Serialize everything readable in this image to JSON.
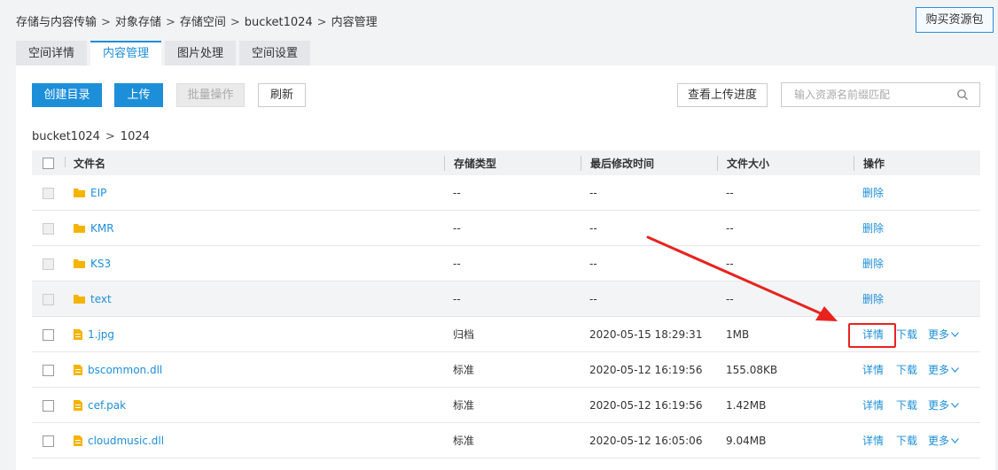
{
  "breadcrumb": [
    "存储与内容传输",
    "对象存储",
    "存储空间",
    "bucket1024",
    "内容管理"
  ],
  "breadcrumb_sep": ">",
  "buy_button": "购买资源包",
  "tabs": [
    {
      "label": "空间详情",
      "active": false
    },
    {
      "label": "内容管理",
      "active": true
    },
    {
      "label": "图片处理",
      "active": false
    },
    {
      "label": "空间设置",
      "active": false
    }
  ],
  "toolbar": {
    "create_dir": "创建目录",
    "upload": "上传",
    "batch": "批量操作",
    "refresh": "刷新",
    "upload_progress": "查看上传进度"
  },
  "search": {
    "placeholder": "输入资源名前缀匹配"
  },
  "path": [
    "bucket1024",
    "1024"
  ],
  "path_sep": ">",
  "columns": {
    "name": "文件名",
    "type": "存储类型",
    "time": "最后修改时间",
    "size": "文件大小",
    "op": "操作"
  },
  "ops": {
    "delete": "删除",
    "detail": "详情",
    "download": "下载",
    "more": "更多"
  },
  "rows": [
    {
      "name": "EIP",
      "kind": "folder",
      "type": "--",
      "time": "--",
      "size": "--"
    },
    {
      "name": "KMR",
      "kind": "folder",
      "type": "--",
      "time": "--",
      "size": "--"
    },
    {
      "name": "KS3",
      "kind": "folder",
      "type": "--",
      "time": "--",
      "size": "--"
    },
    {
      "name": "text",
      "kind": "folder",
      "type": "--",
      "time": "--",
      "size": "--"
    },
    {
      "name": "1.jpg",
      "kind": "file",
      "type": "归档",
      "time": "2020-05-15 18:29:31",
      "size": "1MB"
    },
    {
      "name": "bscommon.dll",
      "kind": "file",
      "type": "标准",
      "time": "2020-05-12 16:19:56",
      "size": "155.08KB"
    },
    {
      "name": "cef.pak",
      "kind": "file",
      "type": "标准",
      "time": "2020-05-12 16:19:56",
      "size": "1.42MB"
    },
    {
      "name": "cloudmusic.dll",
      "kind": "file",
      "type": "标准",
      "time": "2020-05-12 16:05:06",
      "size": "9.04MB"
    }
  ],
  "colors": {
    "accent": "#1d8fd9",
    "annotation": "#e8231e",
    "folder": "#f5b400"
  }
}
